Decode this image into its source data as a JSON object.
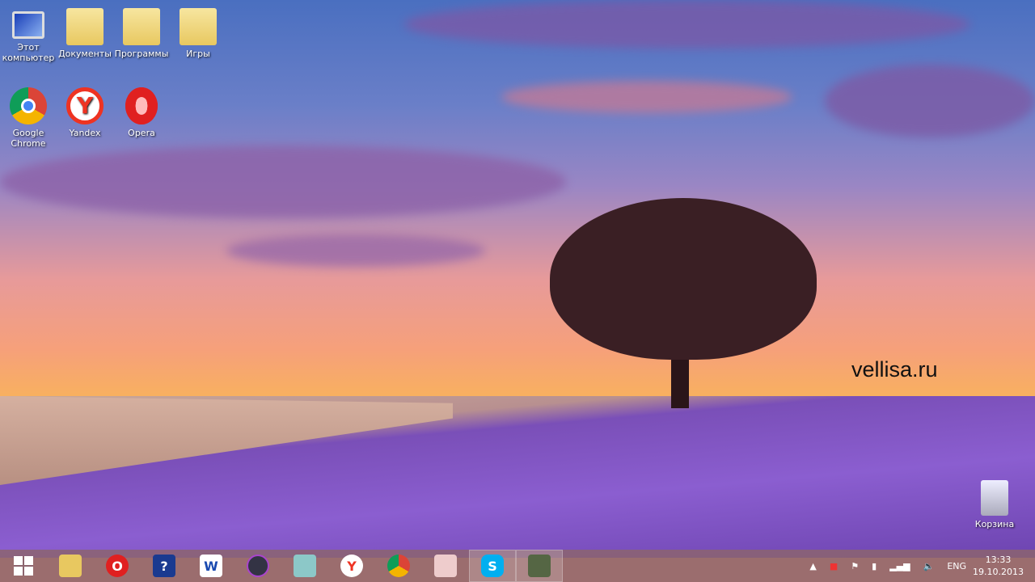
{
  "desktop": {
    "icons": [
      {
        "label": "Этот компьютер",
        "icon": "computer-icon"
      },
      {
        "label": "Документы",
        "icon": "folder-icon"
      },
      {
        "label": "Программы",
        "icon": "folder-icon"
      },
      {
        "label": "Игры",
        "icon": "folder-icon"
      },
      {
        "label": "Google Chrome",
        "icon": "chrome-icon"
      },
      {
        "label": "Yandex",
        "icon": "yandex-icon"
      },
      {
        "label": "Opera",
        "icon": "opera-icon"
      }
    ],
    "recycle_bin": "Корзина",
    "watermark": "vellisa.ru"
  },
  "taskbar": {
    "apps": [
      "start",
      "file-explorer",
      "opera",
      "help",
      "word",
      "media",
      "notes",
      "yandex",
      "chrome",
      "snipping",
      "skype",
      "game"
    ],
    "skype_glyph": "S",
    "opera_glyph": "O",
    "help_glyph": "?",
    "word_glyph": "W",
    "yandex_glyph": "Y",
    "tray": {
      "language": "ENG",
      "time": "13:33",
      "date": "19.10.2013"
    }
  }
}
